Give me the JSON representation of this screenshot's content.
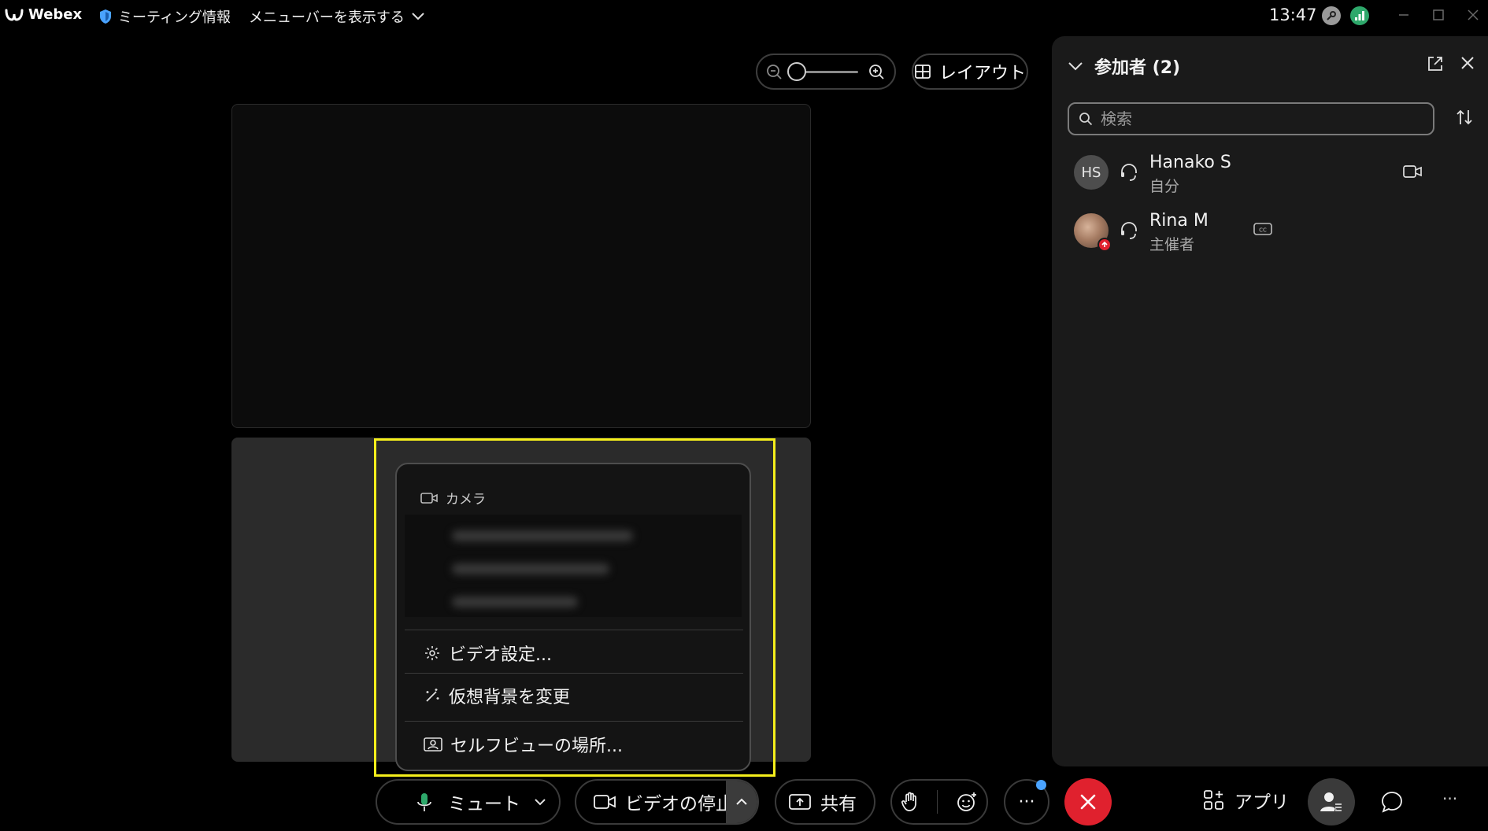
{
  "titlebar": {
    "app_name": "Webex",
    "meeting_info_label": "ミーティング情報",
    "show_menubar_label": "メニューバーを表示する",
    "clock": "13:47"
  },
  "toolbar": {
    "layout_label": "レイアウト"
  },
  "camera_menu": {
    "section_label": "カメラ",
    "items": [
      {
        "label": "ビデオ設定...",
        "icon": "gear-icon"
      },
      {
        "label": "仮想背景を変更",
        "icon": "magic-wand-icon"
      },
      {
        "label": "セルフビューの場所...",
        "icon": "self-view-icon"
      }
    ]
  },
  "controls": {
    "mute_label": "ミュート",
    "video_stop_label": "ビデオの停止",
    "share_label": "共有",
    "more_label": "···",
    "apps_label": "アプリ",
    "overflow_label": "···"
  },
  "participants_panel": {
    "title": "参加者 (2)",
    "search_placeholder": "検索",
    "participants": [
      {
        "initials": "HS",
        "name": "Hanako S",
        "role": "自分"
      },
      {
        "initials": "",
        "name": "Rina M",
        "role": "主催者"
      }
    ]
  },
  "colors": {
    "highlight": "#f4ee1b",
    "end_call": "#e0212e",
    "notification_dot": "#4aa3ff",
    "network_status": "#2ea86b"
  }
}
